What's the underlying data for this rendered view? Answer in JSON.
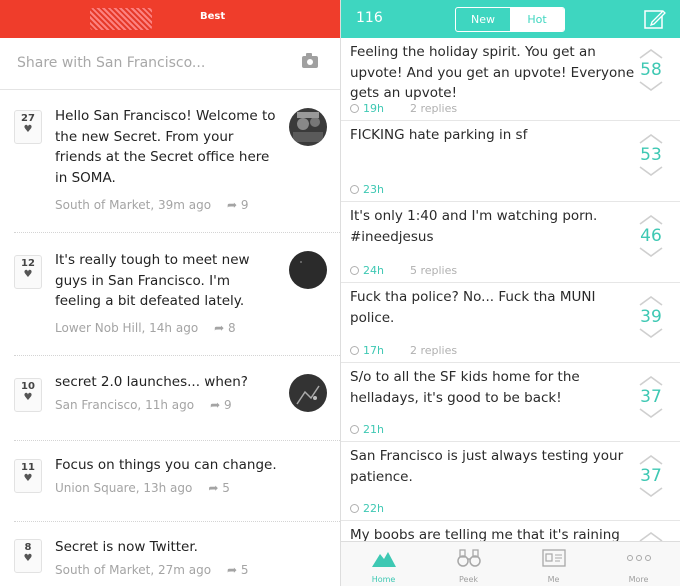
{
  "left": {
    "header": {
      "title": "Best"
    },
    "share": {
      "placeholder": "Share with San Francisco..."
    },
    "posts": [
      {
        "votes": "27",
        "text": "Hello San Francisco! Welcome to the new Secret. From your friends at the Secret office here in SOMA.",
        "location": "South of Market, 39m ago",
        "shares": "9"
      },
      {
        "votes": "12",
        "text": "It's really tough to meet new guys in San Francisco. I'm feeling a bit defeated lately.",
        "location": "Lower Nob Hill, 14h ago",
        "shares": "8"
      },
      {
        "votes": "10",
        "text": "secret 2.0 launches... when?",
        "location": "San Francisco, 11h ago",
        "shares": "9"
      },
      {
        "votes": "11",
        "text": "Focus on things you can change.",
        "location": "Union Square, 13h ago",
        "shares": "5"
      },
      {
        "votes": "8",
        "text": "Secret is now Twitter.",
        "location": "South of Market, 27m ago",
        "shares": "5"
      }
    ]
  },
  "right": {
    "header": {
      "count": "116",
      "tab_new": "New",
      "tab_hot": "Hot"
    },
    "posts": [
      {
        "text": "Feeling the holiday spirit. You get an upvote! And you get an upvote! Everyone gets an upvote!",
        "time": "19h",
        "replies": "2 replies",
        "score": "58"
      },
      {
        "text": "FICKING hate parking in sf",
        "time": "23h",
        "replies": "",
        "score": "53"
      },
      {
        "text": "It's only 1:40 and I'm watching porn. #ineedjesus",
        "time": "24h",
        "replies": "5 replies",
        "score": "46"
      },
      {
        "text": "Fuck tha police? No... Fuck tha MUNI police.",
        "time": "17h",
        "replies": "2 replies",
        "score": "39"
      },
      {
        "text": "S/o to all the SF kids home for the helladays, it's good to be back!",
        "time": "21h",
        "replies": "",
        "score": "37"
      },
      {
        "text": "San Francisco is just always testing your patience.",
        "time": "22h",
        "replies": "",
        "score": "37"
      },
      {
        "text": "My boobs are telling me that it's raining",
        "time": "",
        "replies": "",
        "score": ""
      }
    ],
    "tabbar": {
      "home": "Home",
      "peek": "Peek",
      "me": "Me",
      "more": "More"
    }
  },
  "colors": {
    "left_accent": "#ef3d2b",
    "right_accent": "#3ed6c0",
    "score_teal": "#3ec8b3"
  }
}
